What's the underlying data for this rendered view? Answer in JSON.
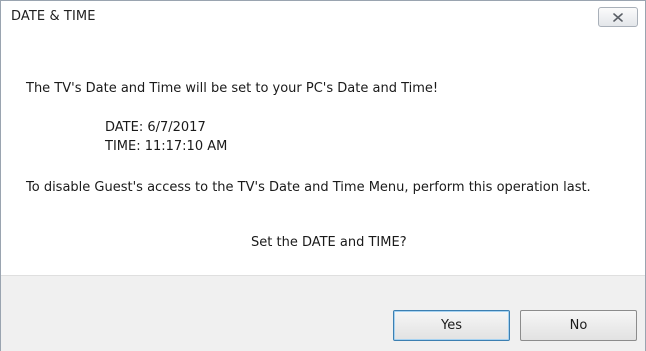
{
  "window": {
    "title": "DATE & TIME"
  },
  "message": {
    "intro": "The TV's Date and Time will be set to your PC's Date and Time!",
    "date_line": "DATE:  6/7/2017",
    "time_line": "TIME:  11:17:10 AM",
    "note": "To disable Guest's access to the TV's Date and Time Menu, perform this operation last.",
    "question": "Set the DATE and TIME?"
  },
  "buttons": {
    "yes_label": "Yes",
    "no_label": "No"
  },
  "icons": {
    "close": "close-icon"
  }
}
